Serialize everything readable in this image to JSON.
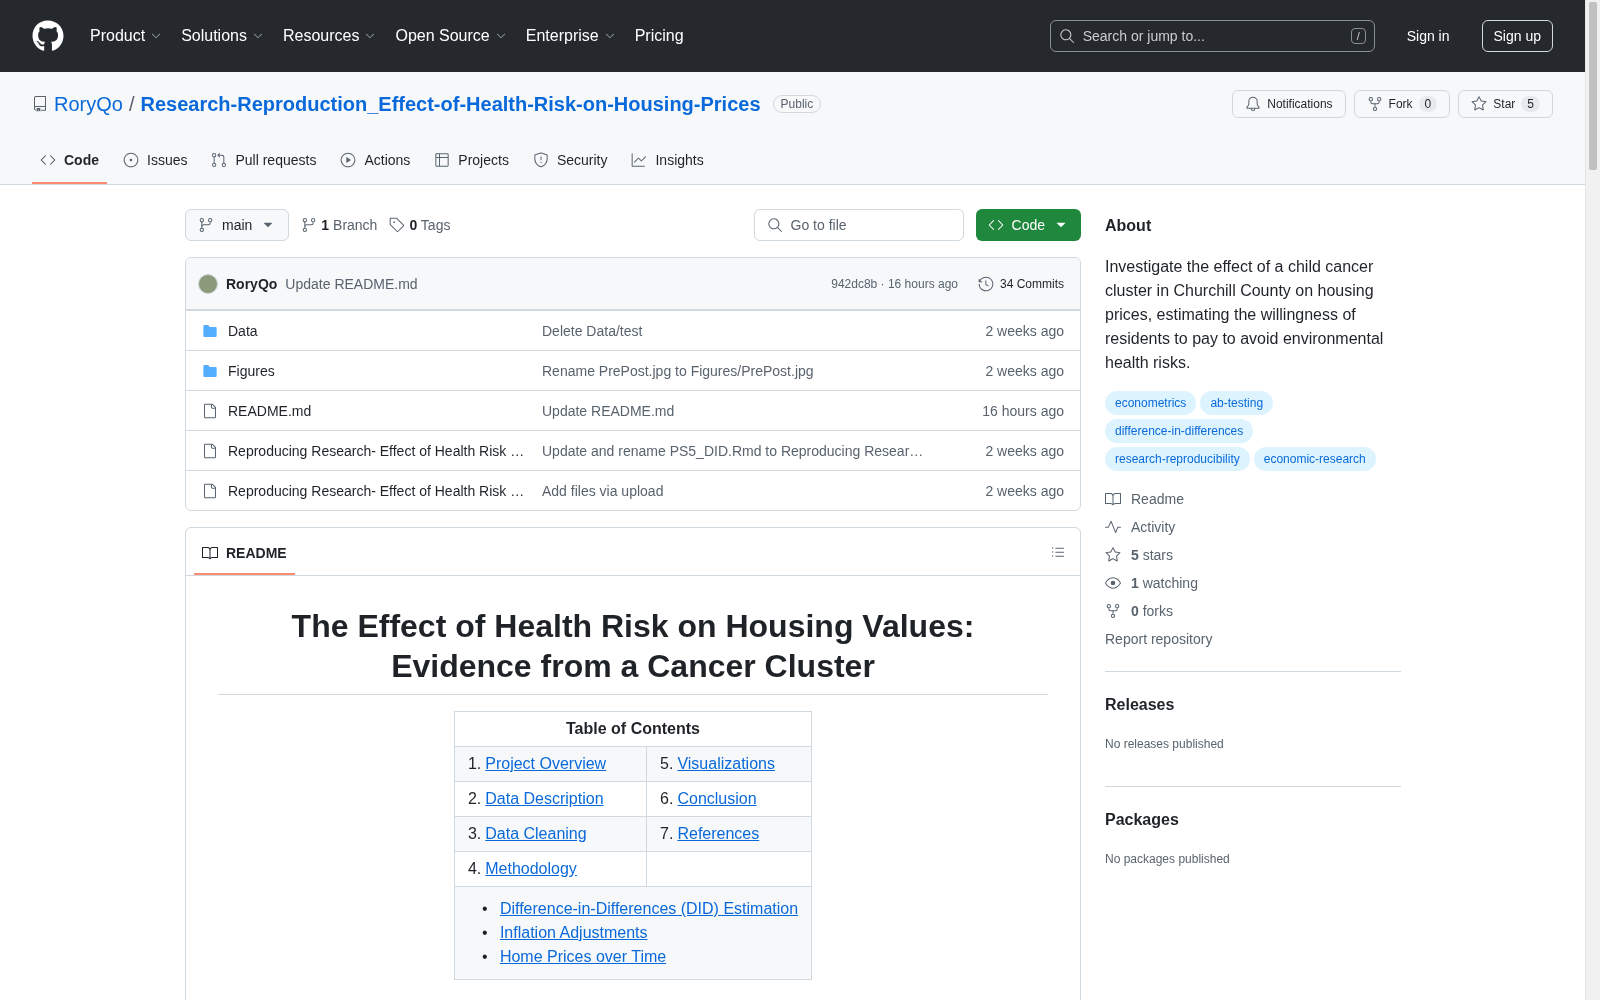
{
  "header": {
    "nav": [
      {
        "label": "Product",
        "dropdown": true
      },
      {
        "label": "Solutions",
        "dropdown": true
      },
      {
        "label": "Resources",
        "dropdown": true
      },
      {
        "label": "Open Source",
        "dropdown": true
      },
      {
        "label": "Enterprise",
        "dropdown": true
      },
      {
        "label": "Pricing",
        "dropdown": false
      }
    ],
    "search": {
      "placeholder": "Search or jump to...",
      "shortcut": "/"
    },
    "sign_in": "Sign in",
    "sign_up": "Sign up"
  },
  "repo": {
    "owner": "RoryQo",
    "separator": "/",
    "name": "Research-Reproduction_Effect-of-Health-Risk-on-Housing-Prices",
    "visibility": "Public",
    "actions": [
      {
        "label": "Notifications"
      },
      {
        "label": "Fork",
        "count": "0"
      },
      {
        "label": "Star",
        "count": "5"
      }
    ]
  },
  "tabs": [
    {
      "label": "Code",
      "selected": true
    },
    {
      "label": "Issues",
      "selected": false
    },
    {
      "label": "Pull requests",
      "selected": false
    },
    {
      "label": "Actions",
      "selected": false
    },
    {
      "label": "Projects",
      "selected": false
    },
    {
      "label": "Security",
      "selected": false
    },
    {
      "label": "Insights",
      "selected": false
    }
  ],
  "toolbar": {
    "branch": "main",
    "branches": "**1** Branch",
    "tags": "**0** Tags",
    "go_to_file": {
      "placeholder": "Go to file"
    },
    "code_button": "Code"
  },
  "commit": {
    "author": "RoryQo",
    "message": "Update README.md",
    "hash_time": "942dc8b · 16 hours ago",
    "commits": "34 Commits"
  },
  "files": [
    {
      "kind": "folder",
      "name": "Data",
      "message": "Delete Data/test",
      "time": "2 weeks ago"
    },
    {
      "kind": "folder",
      "name": "Figures",
      "message": "Rename PrePost.jpg to Figures/PrePost.jpg",
      "time": "2 weeks ago"
    },
    {
      "kind": "file",
      "name": "README.md",
      "message": "Update README.md",
      "time": "16 hours ago"
    },
    {
      "kind": "file",
      "name": "Reproducing Research- Effect of Health Risk …",
      "message": "Update and rename PS5_DID.Rmd to Reproducing Resear…",
      "time": "2 weeks ago"
    },
    {
      "kind": "file",
      "name": "Reproducing Research- Effect of Health Risk …",
      "message": "Add files via upload",
      "time": "2 weeks ago"
    }
  ],
  "readme": {
    "tab": "README",
    "title": "The Effect of Health Risk on Housing Values: Evidence from a Cancer Cluster",
    "toc": {
      "title": "Table of Contents",
      "rows": [
        [
          {
            "number": "1.",
            "link": "Project Overview"
          },
          {
            "number": "5.",
            "link": "Visualizations"
          }
        ],
        [
          {
            "number": "2.",
            "link": "Data Description"
          },
          {
            "number": "6.",
            "link": "Conclusion"
          }
        ],
        [
          {
            "number": "3.",
            "link": "Data Cleaning"
          },
          {
            "number": "7.",
            "link": "References"
          }
        ],
        [
          {
            "number": "4.",
            "link": "Methodology"
          }
        ]
      ],
      "bullet": "•",
      "sub_items": [
        "Difference-in-Differences (DID) Estimation",
        "Inflation Adjustments",
        "Home Prices over Time"
      ]
    }
  },
  "about": {
    "title": "About",
    "description": "Investigate the effect of a child cancer cluster in Churchill County on housing prices, estimating the willingness of residents to pay to avoid environmental health risks.",
    "topics": [
      "econometrics",
      "ab-testing",
      "difference-in-differences",
      "research-reproducibility",
      "economic-research"
    ],
    "links": [
      {
        "text": "Readme"
      },
      {
        "text": "Activity"
      },
      {
        "text": "**5** stars"
      },
      {
        "text": "**1** watching"
      },
      {
        "text": "**0** forks"
      }
    ],
    "report": "Report repository"
  },
  "releases": {
    "title": "Releases",
    "note": "No releases published"
  },
  "packages": {
    "title": "Packages",
    "note": "No packages published"
  }
}
